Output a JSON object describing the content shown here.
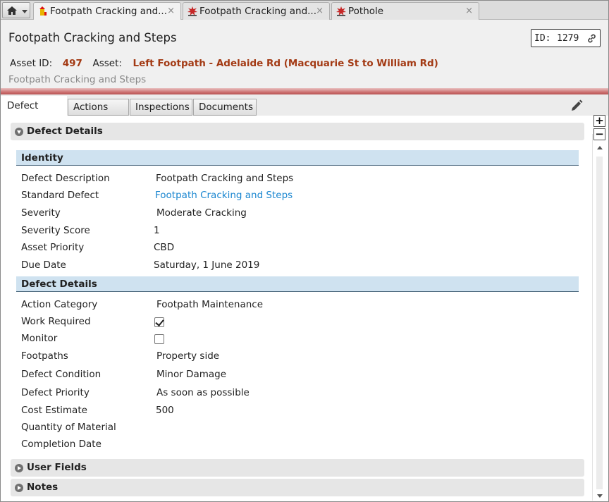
{
  "window_tabs": [
    {
      "label": "Footpath Cracking and...",
      "icon": "asset-defect-icon",
      "active": true
    },
    {
      "label": "Footpath Cracking and...",
      "icon": "defect-burst-icon",
      "active": false
    },
    {
      "label": "Pothole",
      "icon": "defect-burst-icon",
      "active": false
    }
  ],
  "tab_close_glyph": "×",
  "header": {
    "title": "Footpath Cracking and Steps",
    "id_label": "ID:",
    "id_value": "1279",
    "asset_id_label": "Asset ID:",
    "asset_id_value": "497",
    "asset_label": "Asset:",
    "asset_value": "Left Footpath - Adelaide Rd (Macquarie St to William Rd)",
    "subtitle": "Footpath Cracking and Steps"
  },
  "inner_tabs": [
    {
      "label": "Defect",
      "active": true
    },
    {
      "label": "Actions",
      "active": false
    },
    {
      "label": "Inspections",
      "active": false
    },
    {
      "label": "Documents",
      "active": false
    }
  ],
  "zoom": {
    "plus": "+",
    "minus": "−"
  },
  "sections": {
    "defect_details": {
      "title": "Defect Details",
      "expanded": true
    },
    "user_fields": {
      "title": "User Fields",
      "expanded": false
    },
    "notes": {
      "title": "Notes",
      "expanded": false
    }
  },
  "identity": {
    "title": "Identity",
    "rows": [
      {
        "label": "Defect Description",
        "value": "Footpath Cracking and Steps"
      },
      {
        "label": "Standard Defect",
        "value": "Footpath Cracking and Steps"
      },
      {
        "label": "Severity",
        "value": "Moderate Cracking"
      },
      {
        "label": "Severity Score",
        "value": "1"
      },
      {
        "label": "Asset Priority",
        "value": "CBD"
      },
      {
        "label": "Due Date",
        "value": "Saturday, 1 June 2019"
      }
    ]
  },
  "defect_group": {
    "title": "Defect Details",
    "rows": [
      {
        "label": "Action Category",
        "value": "Footpath Maintenance"
      },
      {
        "label": "Work Required",
        "checked": true
      },
      {
        "label": "Monitor",
        "checked": false
      },
      {
        "label": "Footpaths",
        "value": "Property side"
      },
      {
        "label": "Defect Condition",
        "value": "Minor Damage"
      },
      {
        "label": "Defect Priority",
        "value": "As soon as possible"
      },
      {
        "label": "Cost Estimate",
        "value": "500"
      },
      {
        "label": "Quantity of Material",
        "value": ""
      },
      {
        "label": "Completion Date",
        "value": ""
      }
    ]
  },
  "colors": {
    "asset_accent": "#a33a14",
    "link": "#1a86d0",
    "group_header": "#cfe2f0",
    "header_rule": "#c96a6a"
  }
}
